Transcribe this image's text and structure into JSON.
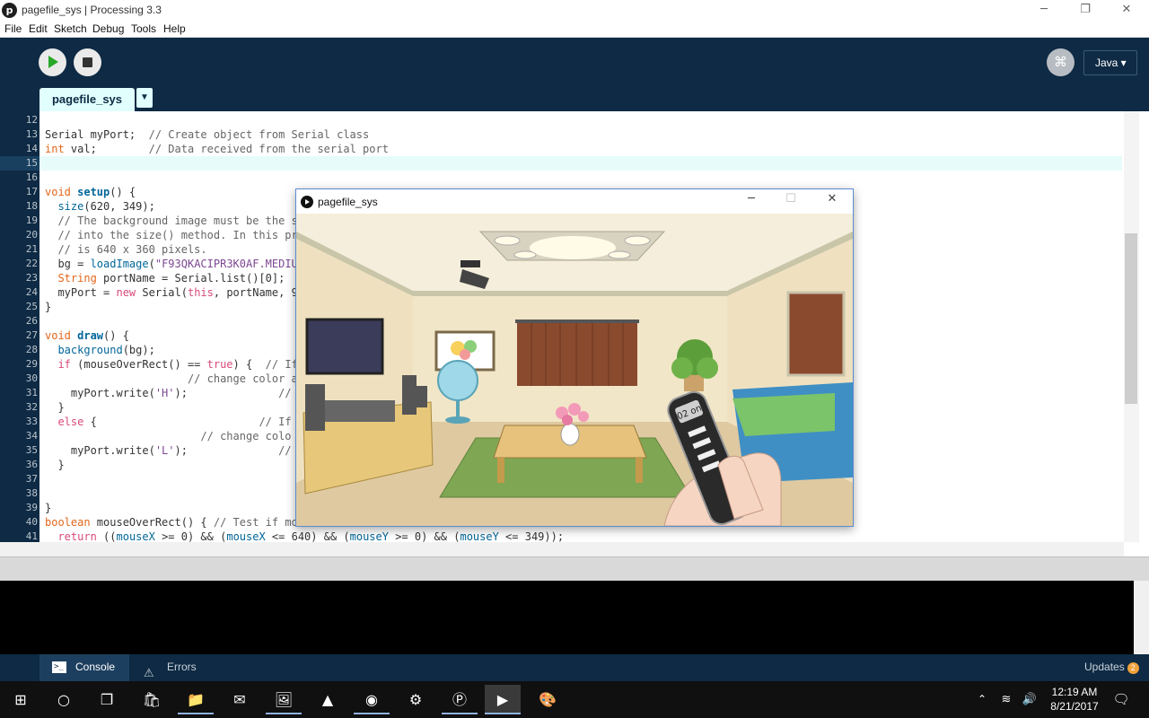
{
  "window": {
    "title": "pagefile_sys | Processing 3.3",
    "minimize": "─",
    "maximize": "❐",
    "close": "✕",
    "app_icon": "p"
  },
  "menu": [
    "File",
    "Edit",
    "Sketch",
    "Debug",
    "Tools",
    "Help"
  ],
  "toolbar": {
    "play_icon": "play-icon",
    "stop_icon": "stop-icon",
    "debug_glyph": "⌘",
    "mode": "Java ▾"
  },
  "tabs": {
    "active": "pagefile_sys",
    "menu_glyph": "▼"
  },
  "editor": {
    "line_numbers": [
      "12",
      "13",
      "14",
      "15",
      "16",
      "17",
      "18",
      "19",
      "20",
      "21",
      "22",
      "23",
      "24",
      "25",
      "26",
      "27",
      "28",
      "29",
      "30",
      "31",
      "32",
      "33",
      "34",
      "35",
      "36",
      "37",
      "38",
      "39",
      "40",
      "41"
    ],
    "code": {
      "l13a": "Serial myPort;  ",
      "l13b": "// Create object from Serial class",
      "l14a": "int",
      "l14b": " val;        ",
      "l14c": "// Data received from the serial port",
      "l17a": "void ",
      "l17b": "setup",
      "l17c": "() {",
      "l18a": "  ",
      "l18b": "size",
      "l18c": "(620, 349);",
      "l19": "  // The background image must be the sa",
      "l20": "  // into the size() method. In this pro",
      "l21": "  // is 640 x 360 pixels.",
      "l22a": "  bg = ",
      "l22b": "loadImage",
      "l22c": "(",
      "l22d": "\"F93QKACIPR3K0AF.MEDIUM",
      "l23a": "  ",
      "l23b": "String",
      "l23c": " portName = Serial.list()[0];",
      "l24a": "  myPort = ",
      "l24b": "new",
      "l24c": " Serial(",
      "l24d": "this",
      "l24e": ", portName, 96",
      "l25": "}",
      "l27a": "void ",
      "l27b": "draw",
      "l27c": "() {",
      "l28a": "  ",
      "l28b": "background",
      "l28c": "(bg);",
      "l29a": "  ",
      "l29b": "if",
      "l29c": " (mouseOverRect() == ",
      "l29d": "true",
      "l29e": ") {  ",
      "l29f": "// If",
      "l30": "                      // change color and",
      "l31a": "    myPort.write(",
      "l31b": "'H'",
      "l31c": ");              ",
      "l31d": "// s",
      "l32": "  }",
      "l33a": "  ",
      "l33b": "else",
      "l33c": " {                         ",
      "l33d": "// If mo",
      "l34": "                        // change colo",
      "l35a": "    myPort.write(",
      "l35b": "'L'",
      "l35c": ");              ",
      "l35d": "// s",
      "l36": "  }",
      "l39": "}",
      "l40a": "boolean",
      "l40b": " mouseOverRect() { ",
      "l40c": "// Test if mou",
      "l41a": "  ",
      "l41b": "return",
      "l41c": " ((",
      "l41d": "mouseX",
      "l41e": " >= 0) && (",
      "l41f": "mouseX",
      "l41g": " <= 640) && (",
      "l41h": "mouseY",
      "l41i": " >= 0) && (",
      "l41j": "mouseY",
      "l41k": " <= 349));"
    }
  },
  "footer": {
    "console": "Console",
    "errors": "Errors",
    "updates": "Updates",
    "updates_count": "2",
    "console_glyph": ">_",
    "errors_glyph": "⚠"
  },
  "sketch_window": {
    "title": "pagefile_sys",
    "minimize": "─",
    "maximize": "☐",
    "close": "✕",
    "remote_label": "02 on"
  },
  "taskbar": {
    "time": "12:19 AM",
    "date": "8/21/2017",
    "icons": [
      "windows-start-icon",
      "cortana-search-icon",
      "task-view-icon",
      "store-icon",
      "file-explorer-icon",
      "mail-icon",
      "photos-icon",
      "vlc-icon",
      "chrome-icon",
      "settings-icon",
      "processing-icon",
      "processing-sketch-icon",
      "paint-icon"
    ]
  },
  "colors": {
    "ide_dark": "#0e2a44",
    "tab_active": "#e0fffd",
    "line_highlight": "#e8fbfb",
    "play_green": "#2aa82a",
    "updates_badge": "#f0a13a"
  }
}
